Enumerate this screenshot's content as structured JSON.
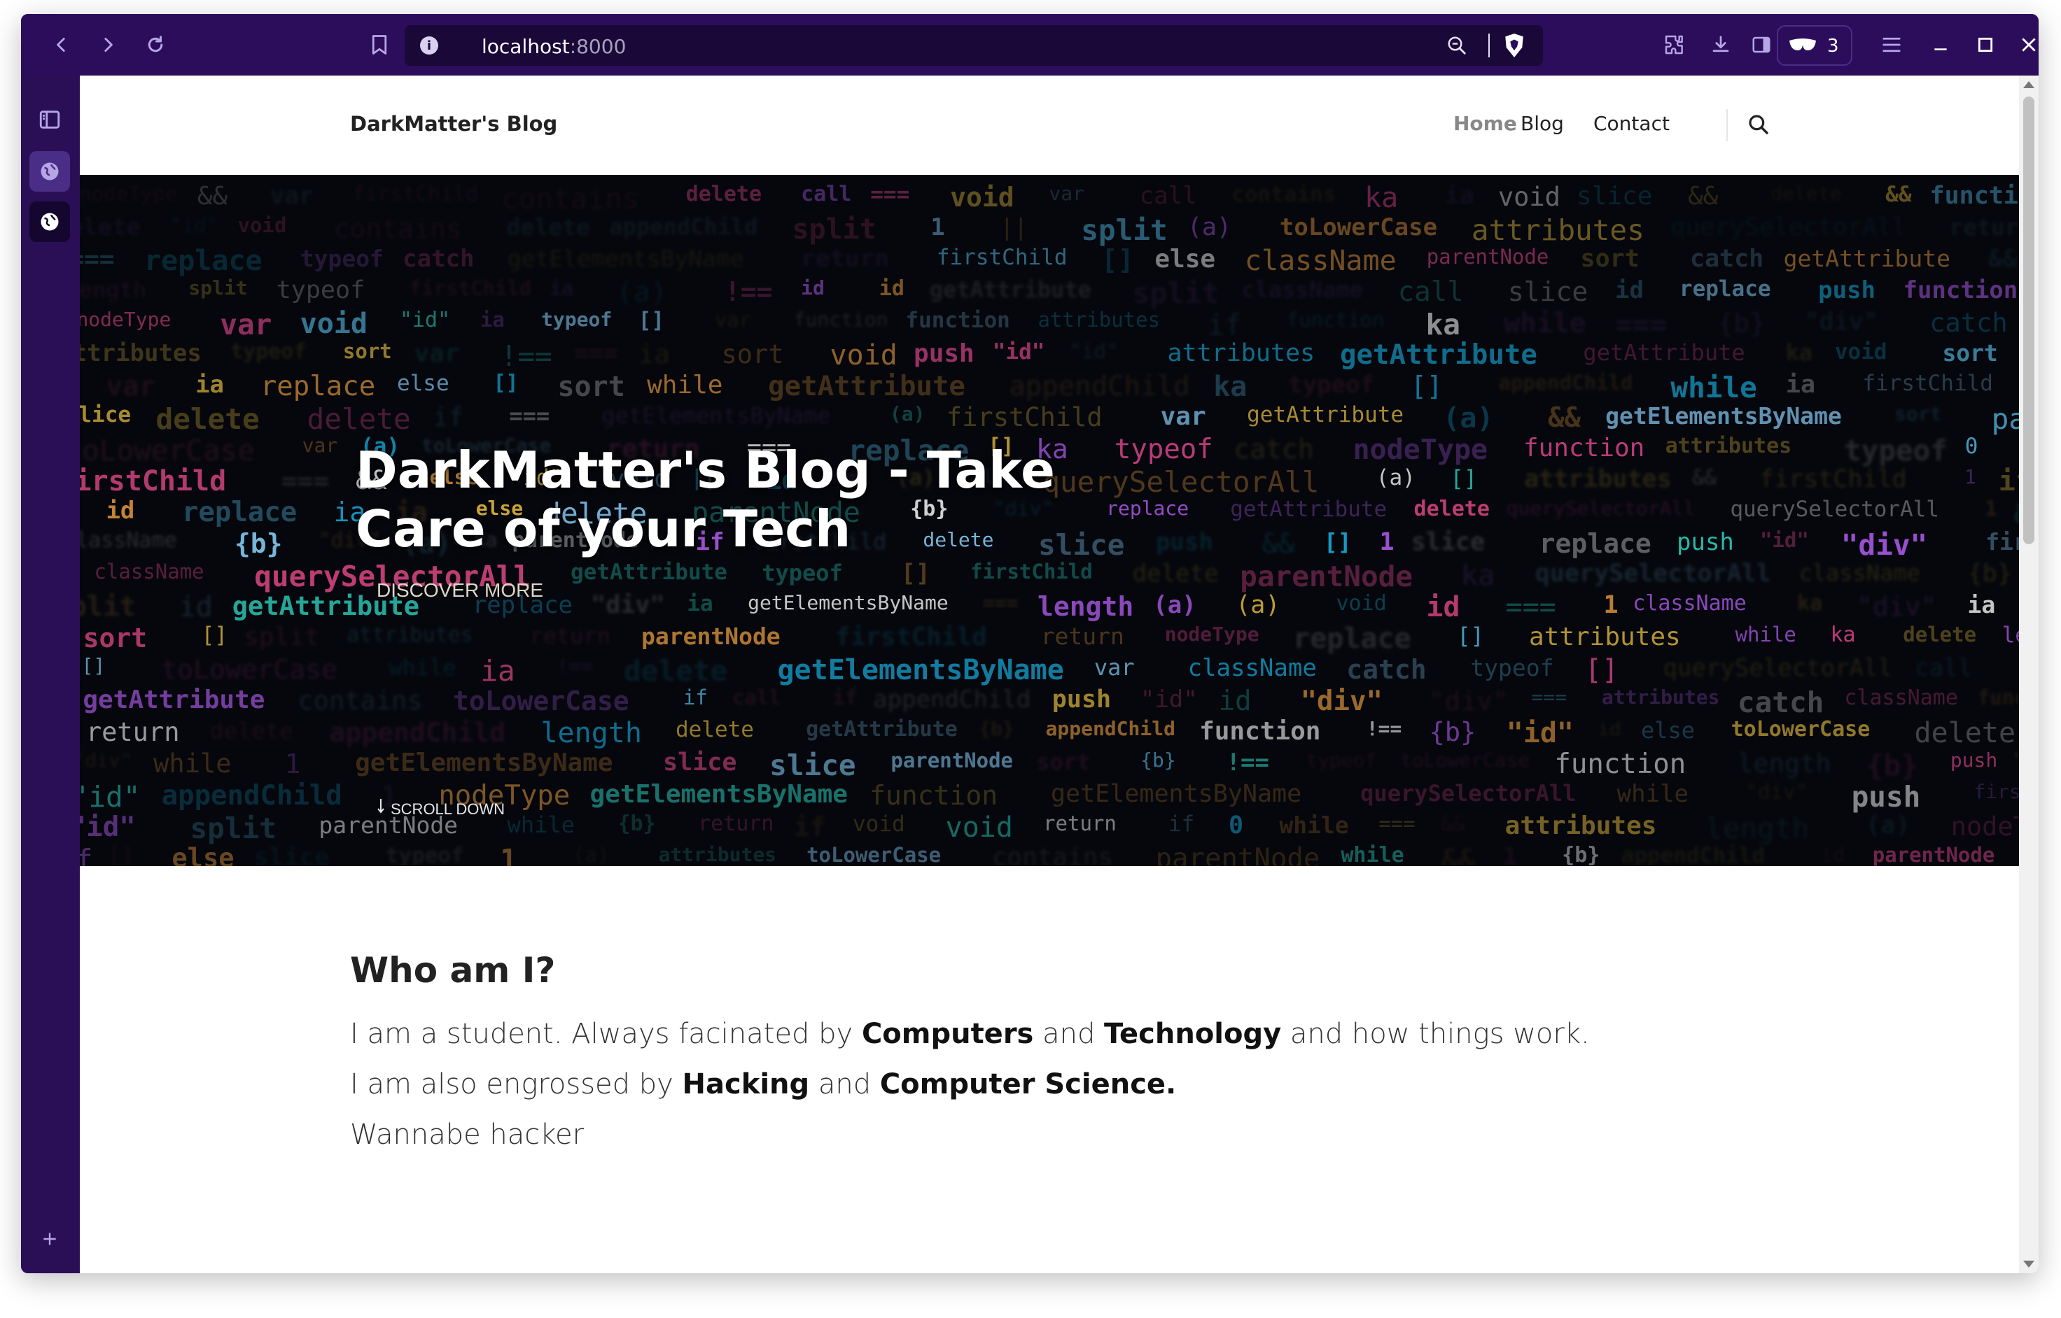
{
  "browser": {
    "url_host": "localhost",
    "url_port": ":8000",
    "shields_count": "3",
    "accent": "#2b0d5c"
  },
  "site": {
    "brand": "DarkMatter's Blog",
    "nav": [
      {
        "label": "Home",
        "active": true
      },
      {
        "label": "Blog",
        "active": false
      },
      {
        "label": "Contact",
        "active": false
      }
    ]
  },
  "hero": {
    "title": "DarkMatter's Blog - Take Care of your Tech",
    "discover": "DISCOVER MORE",
    "scroll_down": "SCROLL DOWN"
  },
  "about": {
    "heading": "Who am I?",
    "line1": {
      "pre": "I am a student. Always facinated by ",
      "b1": "Computers",
      "mid": " and ",
      "b2": "Technology",
      "post": " and how things work."
    },
    "line2": {
      "pre": "I am also engrossed by ",
      "b1": "Hacking",
      "mid": " and ",
      "b2": "Computer Science."
    },
    "line3": "Wannabe hacker"
  },
  "icons": {
    "back": "back-arrow-icon",
    "forward": "forward-arrow-icon",
    "reload": "reload-icon",
    "bookmark": "bookmark-icon",
    "info": "site-info-icon",
    "zoom": "zoom-out-icon",
    "brave": "brave-shield-icon",
    "extensions": "extensions-icon",
    "download": "download-icon",
    "sidebar": "sidebar-panel-icon",
    "menu": "hamburger-menu-icon",
    "search": "search-icon"
  }
}
